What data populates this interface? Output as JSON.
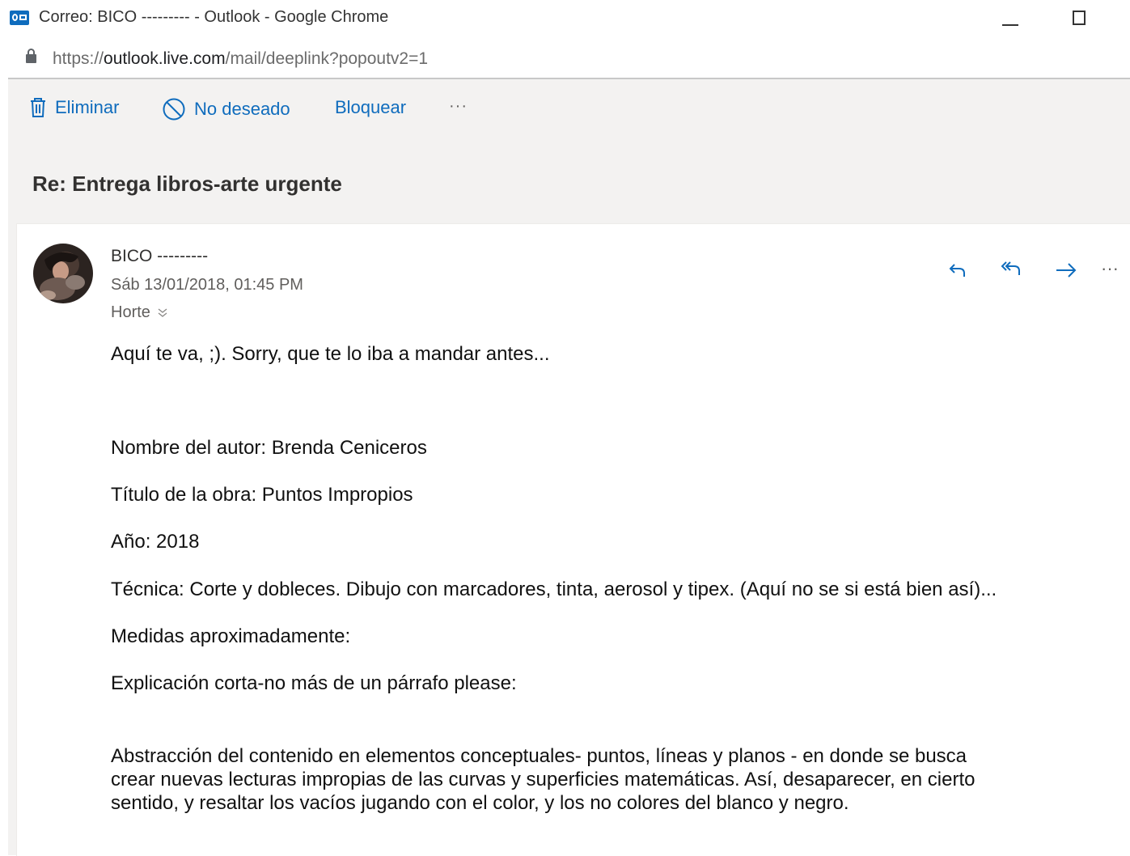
{
  "window": {
    "title": "Correo: BICO --------- - Outlook - Google Chrome",
    "app_icon": "outlook-icon"
  },
  "address_bar": {
    "scheme": "https://",
    "host": "outlook.live.com",
    "path": "/mail/deeplink?popoutv2=1"
  },
  "toolbar": {
    "delete_label": "Eliminar",
    "junk_label": "No deseado",
    "block_label": "Bloquear",
    "more_label": "···"
  },
  "message": {
    "subject": "Re: Entrega libros-arte urgente",
    "sender": "BICO ---------",
    "date": "Sáb 13/01/2018, 01:45 PM",
    "to": "Horte",
    "actions": {
      "reply": "reply-icon",
      "reply_all": "reply-all-icon",
      "forward": "forward-icon",
      "more": "···"
    },
    "body": {
      "intro": "Aquí te va, ;). Sorry, que te lo iba a mandar antes...",
      "author": "Nombre del autor: Brenda Ceniceros",
      "work_title": "Título de la obra: Puntos Impropios",
      "year": "Año: 2018",
      "technique": "Técnica: Corte y dobleces. Dibujo con marcadores, tinta, aerosol y tipex. (Aquí no se si está bien así)...",
      "measures": "Medidas aproximadamente:",
      "explanation_prompt": "Explicación corta-no más de un párrafo please:",
      "explanation_lines": [
        "Abstracción del contenido en elementos conceptuales- puntos, líneas y planos - en donde se busca",
        "crear nuevas lecturas impropias de las curvas y superficies matemáticas. Así, desaparecer, en cierto",
        "sentido, y resaltar los vacíos jugando con el color, y los no colores del blanco y negro."
      ]
    }
  },
  "colors": {
    "accent": "#0f6cbd",
    "frame_bg": "#f3f2f1",
    "card_bg": "#ffffff"
  }
}
